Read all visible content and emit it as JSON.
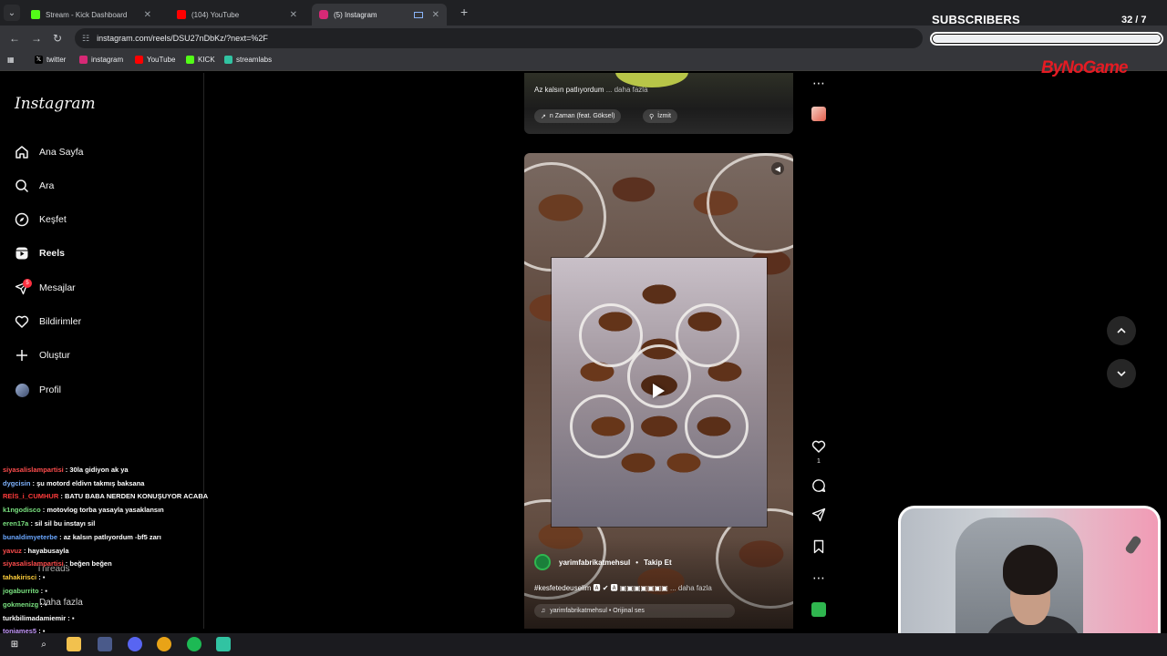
{
  "browser": {
    "tabs": [
      {
        "title": "Stream - Kick Dashboard",
        "color": "#53fc18"
      },
      {
        "title": "(104) YouTube",
        "color": "#ff0000"
      },
      {
        "title": "(5) Instagram",
        "color": "#d62976"
      }
    ],
    "url": "instagram.com/reels/DSU27nDbKz/?next=%2F",
    "bookmarks": [
      {
        "label": "twitter",
        "icon": "x-icon"
      },
      {
        "label": "instagram",
        "icon": "instagram-icon"
      },
      {
        "label": "YouTube",
        "icon": "youtube-icon"
      },
      {
        "label": "KICK",
        "icon": "kick-icon"
      },
      {
        "label": "streamlabs",
        "icon": "streamlabs-icon"
      }
    ]
  },
  "instagram": {
    "logo": "Instagram",
    "nav": [
      {
        "label": "Ana Sayfa",
        "icon": "home-icon"
      },
      {
        "label": "Ara",
        "icon": "search-icon"
      },
      {
        "label": "Keşfet",
        "icon": "compass-icon"
      },
      {
        "label": "Reels",
        "icon": "reels-icon"
      },
      {
        "label": "Mesajlar",
        "icon": "messenger-icon",
        "badge": "5"
      },
      {
        "label": "Bildirimler",
        "icon": "heart-icon"
      },
      {
        "label": "Oluştur",
        "icon": "plus-icon"
      },
      {
        "label": "Profil",
        "icon": "avatar"
      }
    ],
    "threads_label": "Threads",
    "more_label": "Daha fazla",
    "prev_reel": {
      "caption": "Az kalsın patlıyordum",
      "more": "... daha fazla",
      "music": "n Zaman (feat. Göksel)",
      "location": "İzmit"
    },
    "reel": {
      "author": "yarimfabrikatmehsul",
      "follow": "Takip Et",
      "caption": "#kesfetedeuselim",
      "more": "... daha fazla",
      "audio": "yarimfabrikatmehsul • Orijinal ses",
      "likes": "1"
    }
  },
  "overlay": {
    "subs_title": "SUBSCRIBERS",
    "subs_count": "32 / 7",
    "brand": "ByNoGame",
    "chat": [
      {
        "user": "siyasalislampartisi",
        "msg": "30la gidiyon ak ya",
        "color": "#ff4d4d"
      },
      {
        "user": "dygcisin",
        "msg": "şu motord eldivn takmış baksana",
        "color": "#7fb3ff"
      },
      {
        "user": "REİS_i_CUMHUR",
        "msg": "BATU BABA NERDEN KONUŞUYOR ACABA",
        "color": "#ff3b3b"
      },
      {
        "user": "k1ngodisco",
        "msg": "motovlog torba yasayla yasaklansın",
        "color": "#79e07f"
      },
      {
        "user": "eren17a",
        "msg": "sil sil bu instayı sil",
        "color": "#79e07f"
      },
      {
        "user": "bunaldimyeterbe",
        "msg": "az kalsın patlıyordum -bf5 zarı",
        "color": "#6aa7ff"
      },
      {
        "user": "yavuz",
        "msg": "hayabusayla",
        "color": "#ff4d4d"
      },
      {
        "user": "siyasalislampartisi",
        "msg": "beğen beğen",
        "color": "#ff4d4d"
      },
      {
        "user": "tahakirisci",
        "msg": "",
        "color": "#ffcf3b"
      },
      {
        "user": "jogaburrito",
        "msg": "",
        "color": "#79e07f"
      },
      {
        "user": "gokmenizg",
        "msg": "",
        "color": "#79e07f"
      },
      {
        "user": "turkbilimadamiemir",
        "msg": "",
        "color": "#ffffff"
      },
      {
        "user": "tonjames5",
        "msg": "",
        "color": "#c79bff"
      }
    ]
  }
}
